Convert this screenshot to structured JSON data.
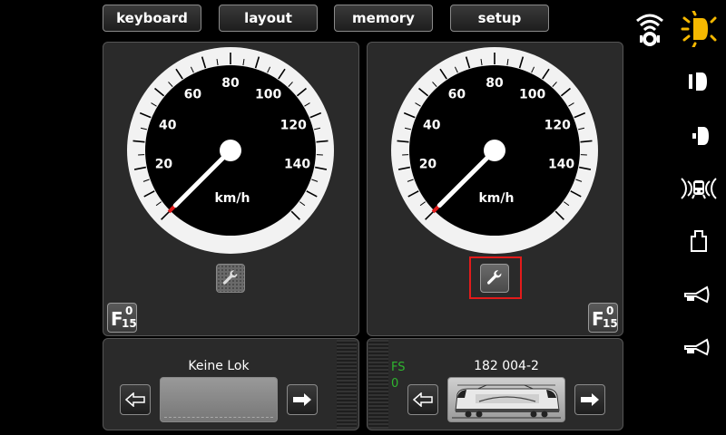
{
  "topbar": {
    "keyboard": "keyboard",
    "layout": "layout",
    "memory": "memory",
    "setup": "setup"
  },
  "gauges": {
    "unit": "km/h",
    "ticks": [
      "20",
      "40",
      "60",
      "80",
      "100",
      "120",
      "140"
    ],
    "left": {
      "speed": 0
    },
    "right": {
      "speed": 0
    }
  },
  "fkeys": {
    "letter": "F",
    "top": "0",
    "bottom": "15"
  },
  "left_loco": {
    "name": "Keine Lok"
  },
  "right_loco": {
    "name": "182 004-2",
    "fs_label": "FS",
    "fs_value": "0"
  },
  "sidebar": {
    "icons": [
      "wifi-icon",
      "light-icon",
      "headlight-icon",
      "rear-light-icon",
      "sound-icon",
      "coupler-icon",
      "horn-high-icon",
      "horn-low-icon"
    ]
  },
  "colors": {
    "accent_red": "#e31b1b",
    "fs_green": "#2fb52f",
    "light_yellow": "#f5b800"
  }
}
